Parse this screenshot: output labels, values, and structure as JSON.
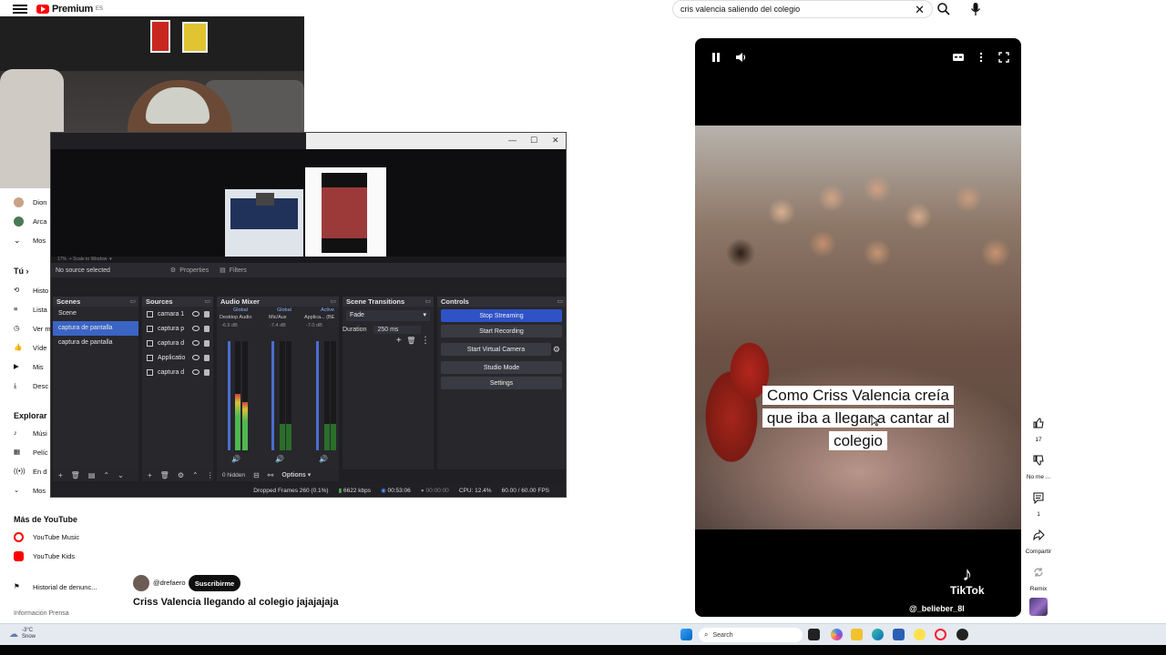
{
  "youtube": {
    "logo_text": "Premium",
    "search_query": "cris valencia saliendo del colegio",
    "sidebar": {
      "subs_items": [
        "Dion",
        "Arca",
        "Mos"
      ],
      "you_header": "Tú",
      "you_items": [
        "Histo",
        "Lista",
        "Ver m",
        "Víde",
        "Mis",
        "Desc"
      ],
      "explore_header": "Explorar",
      "explore_items": [
        "Músi",
        "Pelíc",
        "En d",
        "Mos"
      ],
      "more_header": "Más de YouTube",
      "more_items": [
        "YouTube Music",
        "YouTube Kids"
      ],
      "report": "Historial de denunc...",
      "footer": "Información  Prensa"
    },
    "channel": {
      "handle": "@drefaero",
      "subscribe_label": "Suscribirme"
    },
    "video_title": "Criss Valencia llegando al colegio jajajajaja",
    "short": {
      "caption_lines": [
        "Como Criss Valencia creía",
        "que iba a llegar a cantar al",
        "colegio"
      ],
      "watermark": "TikTok",
      "watermark_handle": "@_belieber_8l"
    },
    "actions": {
      "like_count": "17",
      "dislike_label": "No me ...",
      "comments_count": "1",
      "share_label": "Compartir",
      "remix_label": "Remix"
    },
    "colors": {
      "brand_red": "#ff0000",
      "obs_accent": "#2f52c7"
    }
  },
  "obs": {
    "no_source": "No source selected",
    "properties": "Properties",
    "filters": "Filters",
    "zoom_label": "17%",
    "scale_label": "Scale to Window",
    "scenes": {
      "title": "Scenes",
      "items": [
        "Scene",
        "captura de pantalla",
        "captura de pantalla"
      ],
      "selected_index": 1
    },
    "sources": {
      "title": "Sources",
      "items": [
        "camara 1",
        "captura p",
        "captura d",
        "Applicatio",
        "captura d"
      ]
    },
    "mixer": {
      "title": "Audio Mixer",
      "channels": [
        {
          "tag": "Global",
          "name": "Desktop Audio",
          "db": "-6.9 dB"
        },
        {
          "tag": "Global",
          "name": "Mic/Aux",
          "db": "-7.4 dB"
        },
        {
          "tag": "Active",
          "name": "Applica... (BE",
          "db": "-7.0 dB"
        }
      ]
    },
    "transitions": {
      "title": "Scene Transitions",
      "type": "Fade",
      "duration_label": "Duration",
      "duration_value": "250 ms"
    },
    "controls": {
      "title": "Controls",
      "buttons": [
        "Stop Streaming",
        "Start Recording",
        "Start Virtual Camera",
        "Studio Mode",
        "Settings"
      ]
    },
    "footer": {
      "hidden": "0 hidden",
      "options": "Options"
    },
    "status": {
      "dropped": "Dropped Frames 260 (0.1%)",
      "kbps": "6622 kbps",
      "stream_time": "00:53:06",
      "rec_time": "00:00:00",
      "cpu": "CPU: 12.4%",
      "fps": "60.00 / 60.00 FPS"
    }
  },
  "taskbar": {
    "weather_temp": "-3°C",
    "weather_desc": "Snow",
    "search_placeholder": "Search"
  }
}
